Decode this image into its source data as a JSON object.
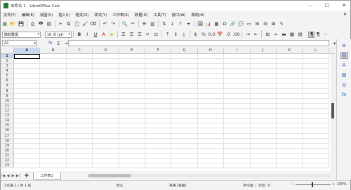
{
  "window": {
    "title": "未命名 1 - LibreOffice Calc",
    "controls": [
      "minimize-icon",
      "maximize-icon",
      "close-icon"
    ]
  },
  "menubar": {
    "items": [
      "文件(F)",
      "编辑(E)",
      "视图(V)",
      "插入(I)",
      "格式(O)",
      "样式(Y)",
      "工作表(S)",
      "数据(D)",
      "工具(T)",
      "窗口(W)",
      "帮助(H)"
    ],
    "close_glyph": "✕"
  },
  "toolbar2": {
    "font_name": "微软雅黑",
    "font_size": "10 点 (pt)"
  },
  "formula_bar": {
    "name_box": "A1",
    "fx_label": "fx",
    "sum_label": "Σ",
    "equals_label": "="
  },
  "grid": {
    "columns": [
      "A",
      "B",
      "C",
      "D",
      "E",
      "F",
      "G",
      "H",
      "I",
      "J",
      "K",
      "L"
    ],
    "rows": [
      "1",
      "2",
      "3",
      "4",
      "5",
      "6",
      "7",
      "8",
      "9",
      "10",
      "11",
      "12",
      "13",
      "14",
      "15",
      "16",
      "17",
      "18",
      "19",
      "20",
      "21",
      "22",
      "23"
    ],
    "selected_cell": "A1"
  },
  "sheet_tabs": {
    "add_label": "+",
    "tabs": [
      "工作表1"
    ]
  },
  "statusbar": {
    "sheet_info": "工作表 1 / 共 1 张",
    "page_style": "默认",
    "language": "英语 (美国)",
    "selection_stats": "平均值：；求和：0",
    "zoom": "100%",
    "zoom_minus": "−",
    "zoom_plus": "+"
  },
  "sidebar": {
    "icons": [
      "properties-icon",
      "styles-icon",
      "gallery-icon",
      "navigator-icon",
      "functions-icon"
    ]
  },
  "colors": {
    "selection_header": "#c8d8ee",
    "accent_blue": "#2a5db0",
    "accent_green": "#1e7e34"
  }
}
